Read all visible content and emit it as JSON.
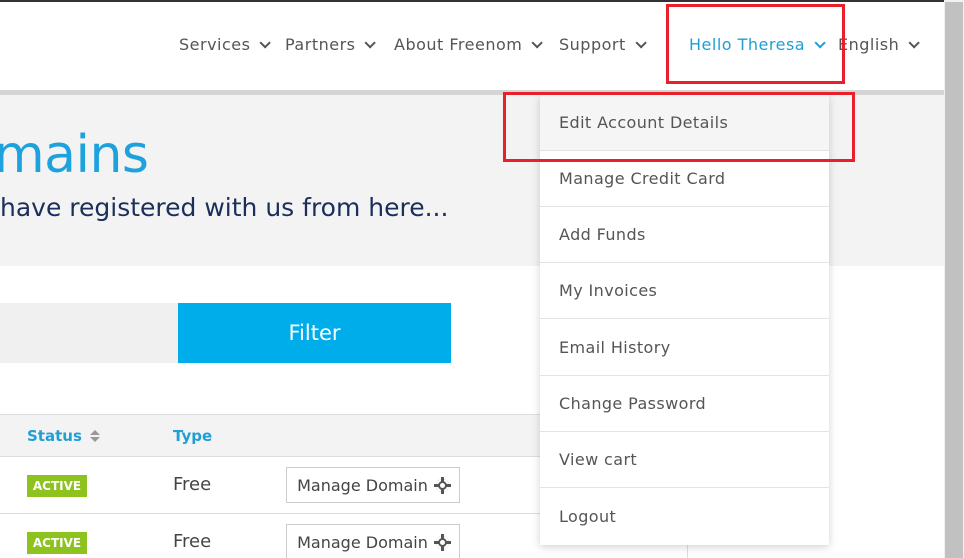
{
  "nav": {
    "items": [
      {
        "label": "Services"
      },
      {
        "label": "Partners"
      },
      {
        "label": "About Freenom"
      },
      {
        "label": "Support"
      },
      {
        "label": "Hello Theresa"
      },
      {
        "label": "English"
      }
    ]
  },
  "hero": {
    "title": "mains",
    "subtitle": "have registered with us from here..."
  },
  "filter": {
    "search_value": "",
    "button_label": "Filter"
  },
  "table": {
    "headers": {
      "status": "Status",
      "type": "Type"
    },
    "rows": [
      {
        "status": "ACTIVE",
        "type": "Free",
        "action": "Manage Domain"
      },
      {
        "status": "ACTIVE",
        "type": "Free",
        "action": "Manage Domain"
      }
    ]
  },
  "dropdown": {
    "items": [
      {
        "label": "Edit Account Details"
      },
      {
        "label": "Manage Credit Card"
      },
      {
        "label": "Add Funds"
      },
      {
        "label": "My Invoices"
      },
      {
        "label": "Email History"
      },
      {
        "label": "Change Password"
      },
      {
        "label": "View cart"
      },
      {
        "label": "Logout"
      }
    ]
  },
  "colors": {
    "accent": "#1e9fd6",
    "filter_button": "#00adeb",
    "active_badge": "#8dc21f",
    "highlight": "#e8202a",
    "subtitle": "#1b2f5a"
  }
}
